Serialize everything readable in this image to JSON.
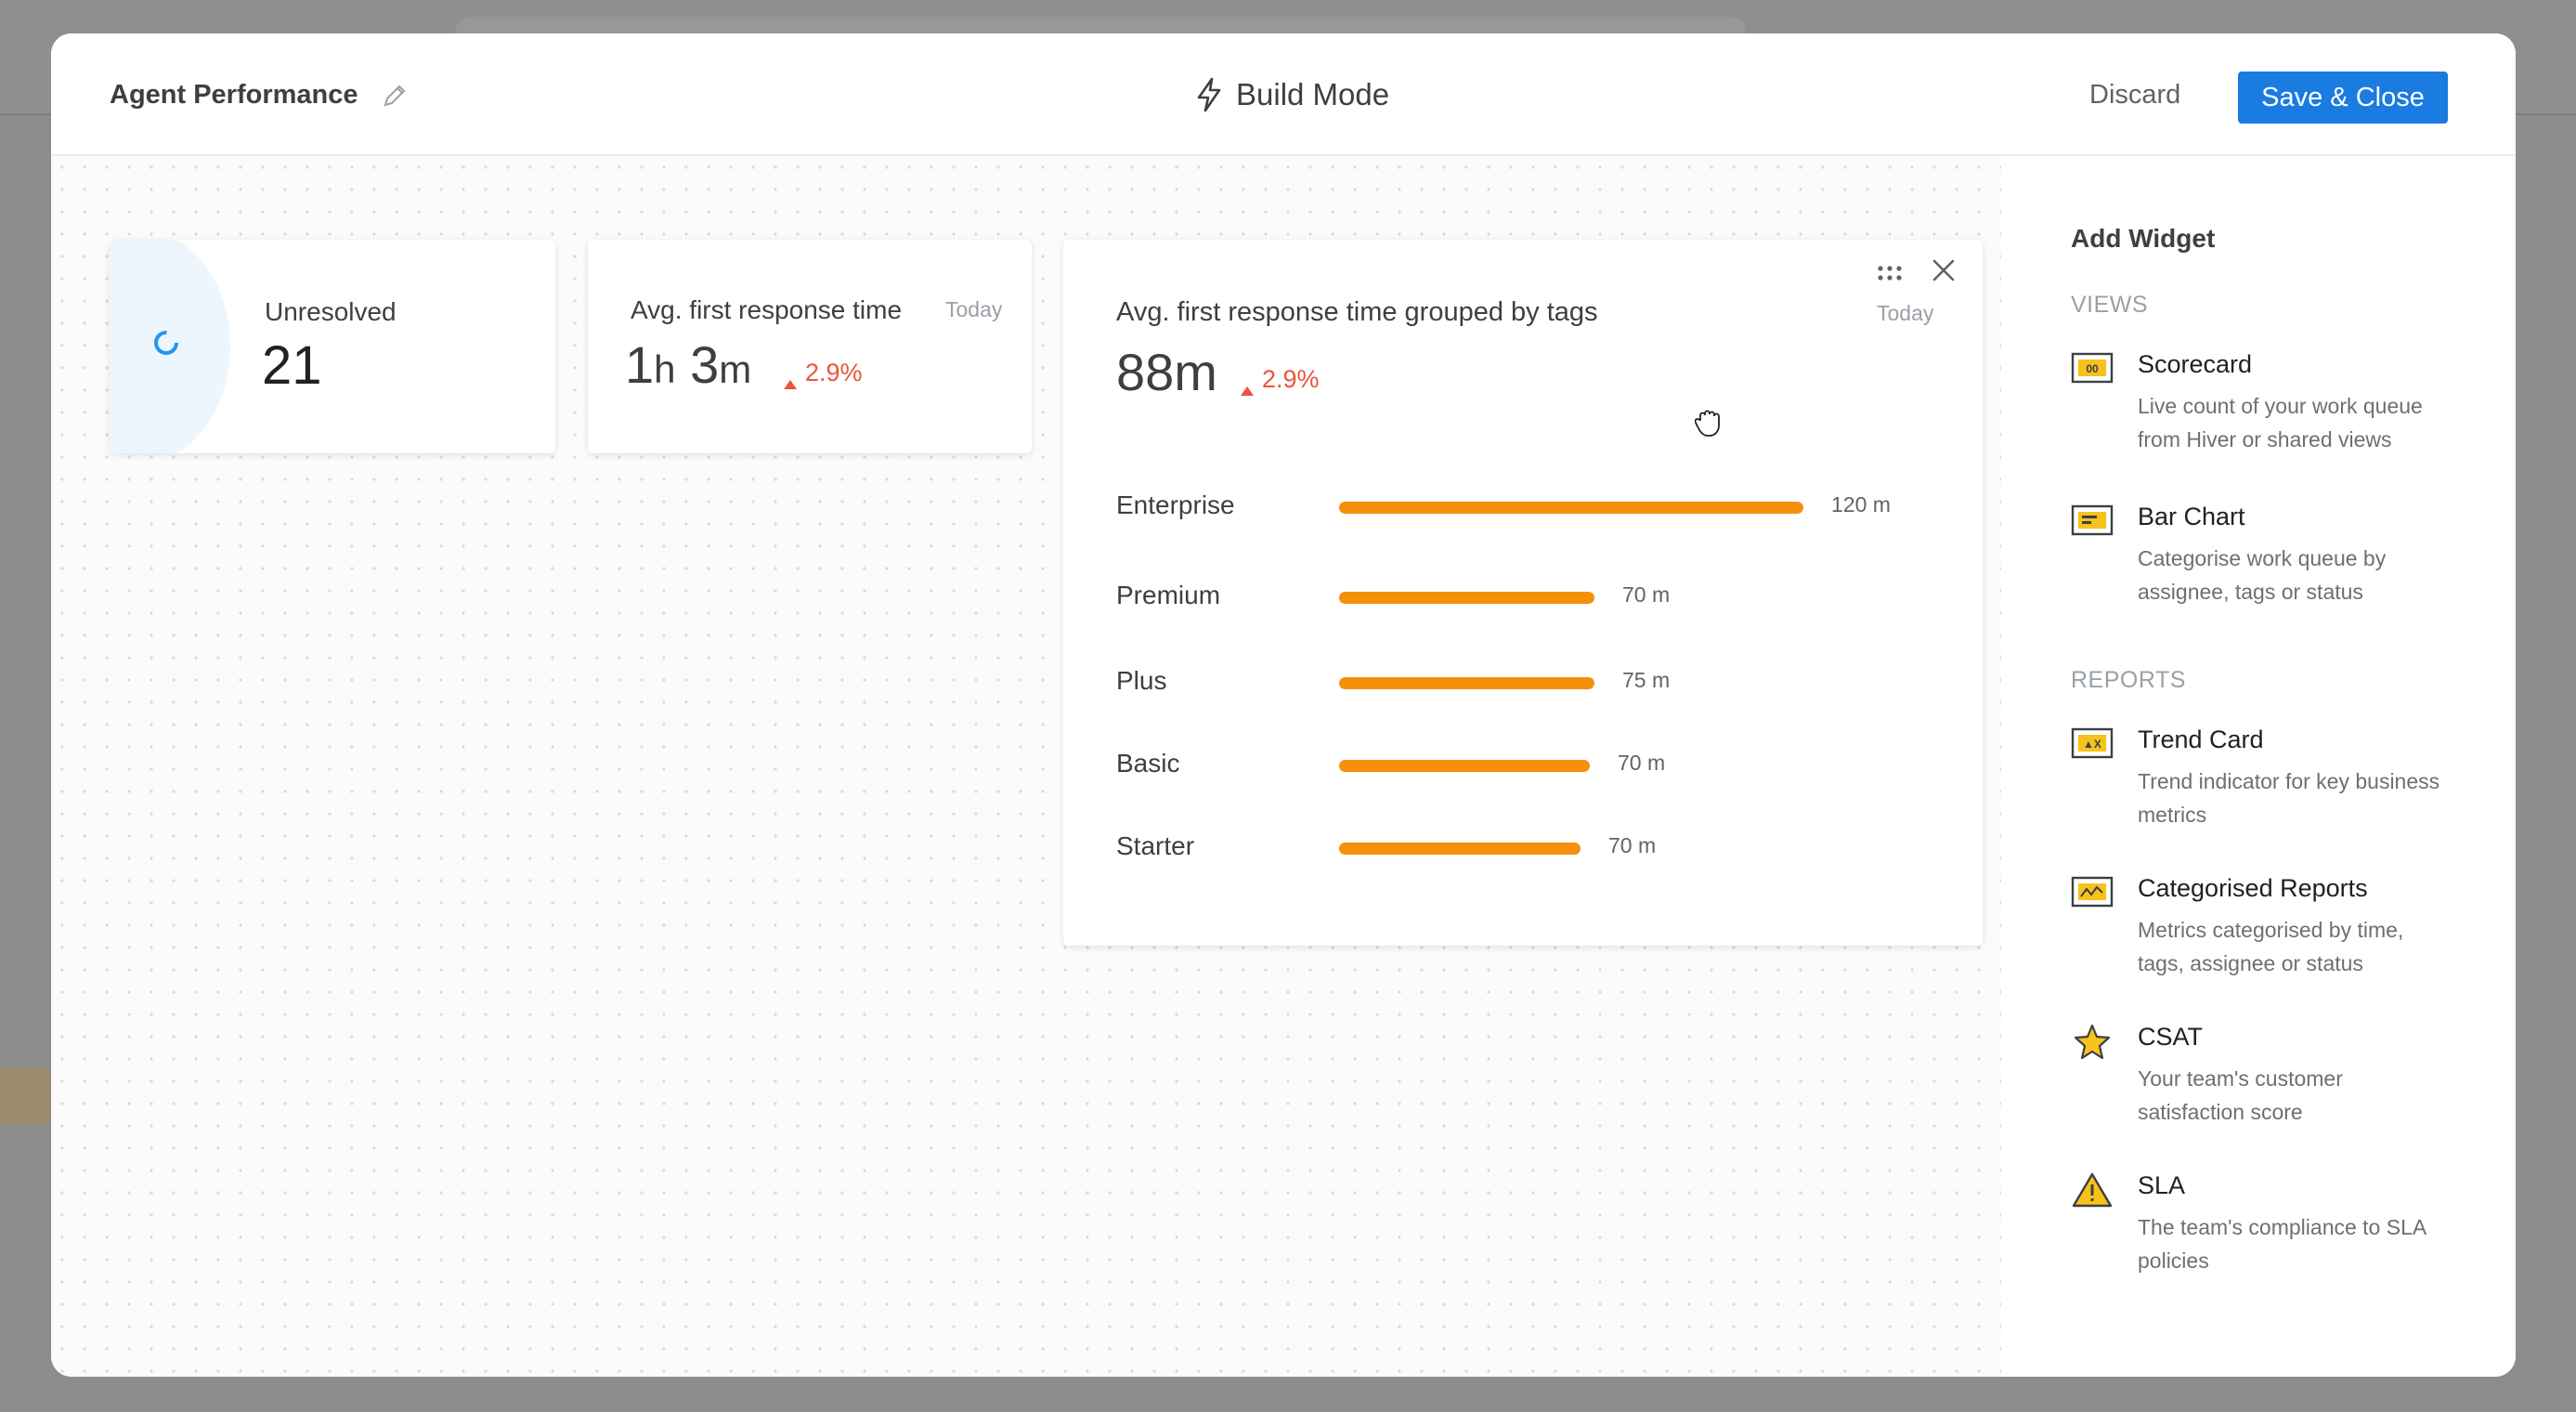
{
  "header": {
    "title": "Agent Performance",
    "mode_label": "Build Mode",
    "discard_label": "Discard",
    "save_label": "Save & Close"
  },
  "widgets": {
    "unresolved": {
      "label": "Unresolved",
      "value": "21"
    },
    "first_response": {
      "label": "Avg. first response time",
      "period": "Today",
      "value_hours": "1",
      "hours_unit": "h",
      "value_minutes": "3",
      "minutes_unit": "m",
      "delta": "2.9%"
    },
    "by_tags": {
      "title": "Avg. first response time grouped by tags",
      "period": "Today",
      "value_number": "88",
      "value_unit": "m",
      "delta": "2.9%"
    }
  },
  "chart_data": {
    "type": "bar",
    "orientation": "horizontal",
    "title": "Avg. first response time grouped by tags",
    "categories": [
      "Enterprise",
      "Premium",
      "Plus",
      "Basic",
      "Starter"
    ],
    "values": [
      120,
      70,
      75,
      70,
      70
    ],
    "value_labels": [
      "120 m",
      "70 m",
      "75 m",
      "70 m",
      "70 m"
    ],
    "bar_fill_fractions": [
      1.0,
      0.55,
      0.55,
      0.54,
      0.52
    ],
    "unit": "m",
    "color": "#f5900b"
  },
  "sidebar": {
    "heading": "Add Widget",
    "views_label": "VIEWS",
    "reports_label": "REPORTS",
    "views": [
      {
        "icon": "scorecard-icon",
        "icon_text": "00",
        "title": "Scorecard",
        "desc": "Live count of your work queue from Hiver or shared views"
      },
      {
        "icon": "bar-chart-icon",
        "title": "Bar Chart",
        "desc": "Categorise work queue by assignee, tags or status"
      }
    ],
    "reports": [
      {
        "icon": "trend-card-icon",
        "icon_text": "▲X",
        "title": "Trend Card",
        "desc": "Trend indicator for key business metrics"
      },
      {
        "icon": "categorised-reports-icon",
        "title": "Categorised Reports",
        "desc": "Metrics categorised by time, tags, assignee or status"
      },
      {
        "icon": "star-icon",
        "title": "CSAT",
        "desc": "Your team's customer satisfaction score"
      },
      {
        "icon": "warning-icon",
        "title": "SLA",
        "desc": "The team's compliance to SLA policies"
      }
    ]
  },
  "colors": {
    "accent": "#1a7be0",
    "bar": "#f5900b",
    "delta_negative": "#e8563a",
    "icon_yellow": "#f7c21b"
  }
}
